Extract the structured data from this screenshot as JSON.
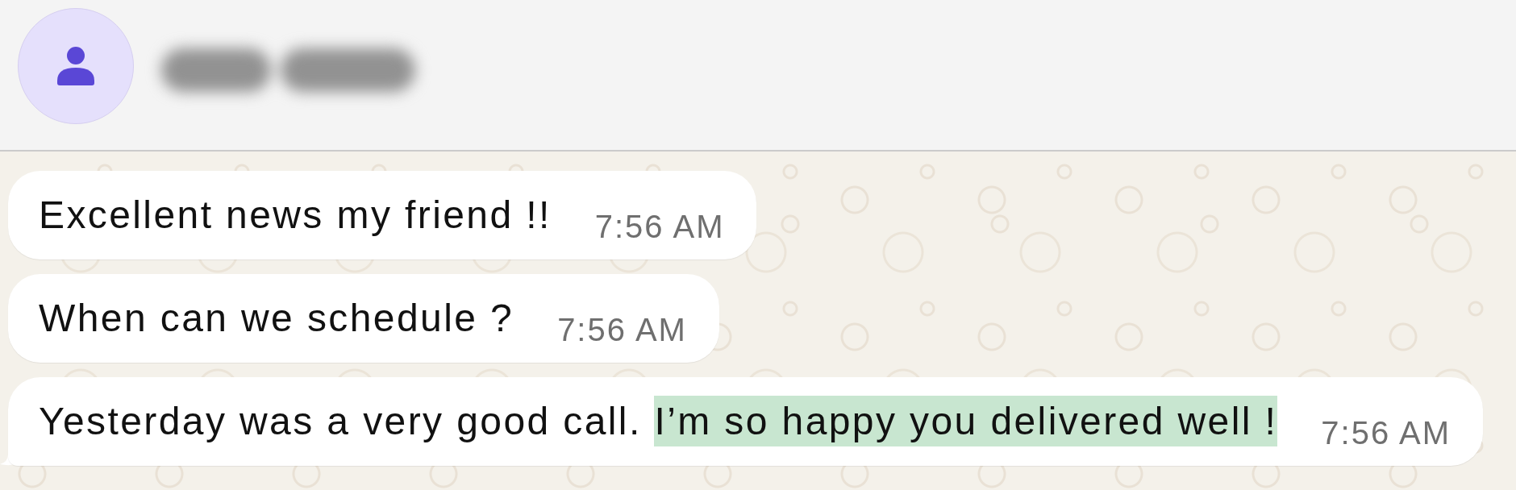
{
  "header": {
    "contact_name_redacted": true
  },
  "messages": [
    {
      "tail": false,
      "segments": [
        {
          "text": "Excellent news my friend !!",
          "selected": false
        }
      ],
      "time": "7:56 AM"
    },
    {
      "tail": false,
      "segments": [
        {
          "text": "When can we schedule ?",
          "selected": false
        }
      ],
      "time": "7:56 AM"
    },
    {
      "tail": true,
      "segments": [
        {
          "text": "Yesterday was a very good call. ",
          "selected": false
        },
        {
          "text": "I’m so happy you delivered well !",
          "selected": true
        }
      ],
      "time": "7:56 AM"
    }
  ]
}
